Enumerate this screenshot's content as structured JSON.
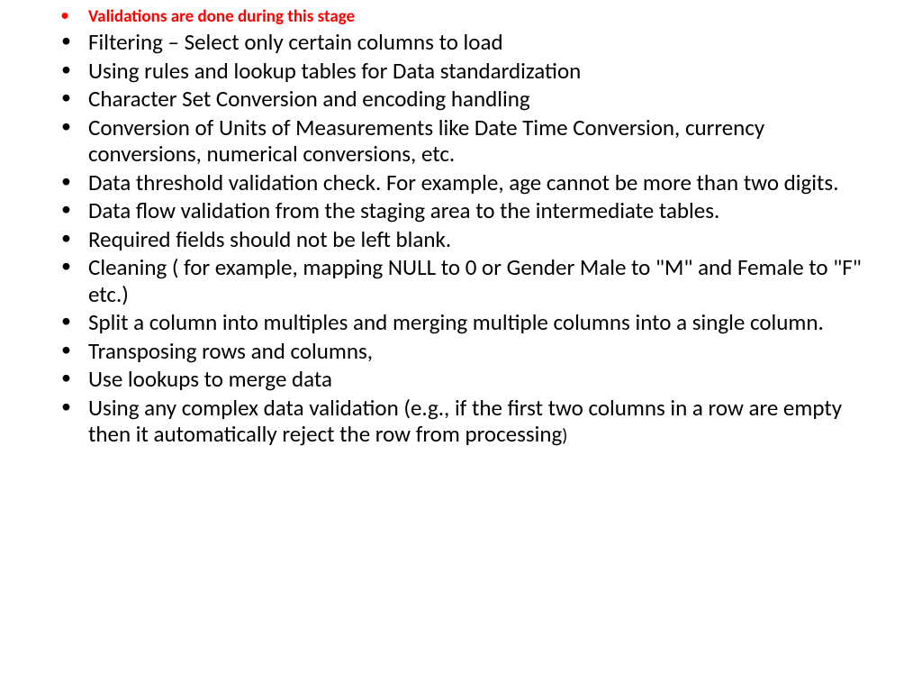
{
  "bullets": [
    {
      "text": "Validations are done during this stage",
      "highlight": true
    },
    {
      "text": "Filtering – Select only certain columns to load",
      "highlight": false
    },
    {
      "text": "Using rules and lookup tables for Data standardization",
      "highlight": false
    },
    {
      "text": "Character Set Conversion and encoding handling",
      "highlight": false
    },
    {
      "text": "Conversion of Units of Measurements like Date Time Conversion, currency conversions, numerical conversions, etc.",
      "highlight": false
    },
    {
      "text": "Data threshold validation check. For example, age cannot be more than two digits.",
      "highlight": false
    },
    {
      "text": "Data flow validation from the staging area to the intermediate tables.",
      "highlight": false
    },
    {
      "text": "Required fields should not be left blank.",
      "highlight": false
    },
    {
      "text": "Cleaning ( for example, mapping NULL to 0 or Gender Male to \"M\" and Female to \"F\" etc.)",
      "highlight": false
    },
    {
      "text": "Split a column into multiples and merging multiple columns into a single column.",
      "highlight": false
    },
    {
      "text": "Transposing rows and columns,",
      "highlight": false
    },
    {
      "text": "Use lookups to merge data",
      "highlight": false
    },
    {
      "text": "Using any complex data validation (e.g., if the first two columns in a row are empty then it automatically reject the row from processing",
      "highlight": false,
      "tail": ")"
    }
  ]
}
